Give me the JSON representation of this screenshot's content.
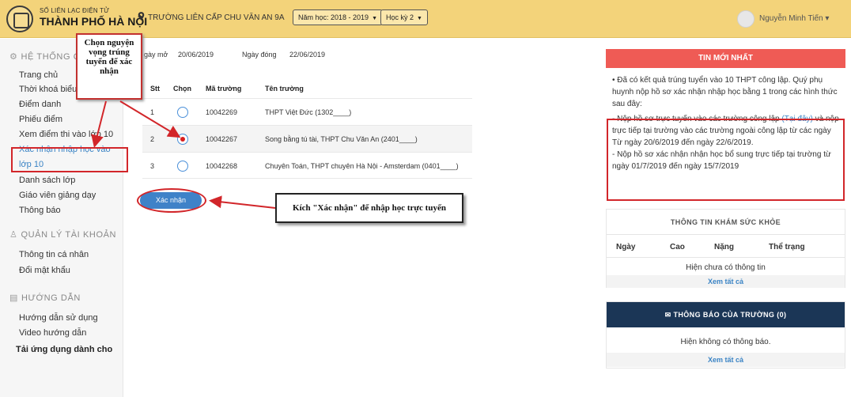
{
  "header": {
    "brand_small": "SỐ LIÊN LẠC ĐIỆN TỬ",
    "brand_big": "THÀNH PHỐ HÀ NỘI",
    "school": "TRƯỜNG LIÊN CẤP CHU VĂN AN 9A",
    "year_select": "Năm học: 2018 - 2019",
    "term_select": "Học kỳ 2",
    "user_name": "Nguyễn Minh Tiến",
    "user_caret": "▾",
    "accent": "#f3d37a"
  },
  "sidebar": {
    "section1": "HỆ THỐNG QU",
    "items1": [
      "Trang chủ",
      "Thời khoá biểu",
      "Điểm danh",
      "Phiếu điểm",
      "Xem điểm thi vào lớp 10",
      "Xác nhận nhập học vào",
      "lớp 10",
      "Danh sách lớp",
      "Giáo viên giảng dạy",
      "Thông báo"
    ],
    "section2": "QUẢN LÝ TÀI KHOẢN",
    "items2": [
      "Thông tin cá nhân",
      "Đổi mật khẩu"
    ],
    "section3": "HƯỚNG DẪN",
    "items3": [
      "Hướng dẫn sử dụng",
      "Video hướng dẫn"
    ],
    "download": "Tải ứng dụng dành cho"
  },
  "main": {
    "open_label": "gày mở",
    "open_date": "20/06/2019",
    "close_label": "Ngày đóng",
    "close_date": "22/06/2019",
    "columns": [
      "Stt",
      "Chọn",
      "Mã trường",
      "Tên trường"
    ],
    "rows": [
      {
        "stt": "1",
        "code": "10042269",
        "name": "THPT Việt Đức (1302____)",
        "selected": false
      },
      {
        "stt": "2",
        "code": "10042267",
        "name": "Song bằng tú tài, THPT Chu Văn An (2401____)",
        "selected": true
      },
      {
        "stt": "3",
        "code": "10042268",
        "name": "Chuyên Toán, THPT chuyên Hà Nội - Amsterdam (0401____)",
        "selected": false
      }
    ],
    "confirm": "Xác nhận"
  },
  "callouts": {
    "choose": [
      "Chọn nguyện",
      "vọng trúng",
      "tuyển để xác",
      "nhận"
    ],
    "confirm_hint": "Kích \"Xác nhận\" để nhập học trực tuyến"
  },
  "news": {
    "title": "TIN MỚI NHẤT",
    "intro": "• Đã có kết quả trúng tuyển vào 10 THPT công lập. Quý phụ huynh nộp hồ sơ xác nhận nhập học bằng 1 trong các hình thức sau đây:",
    "line1_a": "-     Nộp hồ sơ trực tuyến vào các trường công lập",
    "line1_link": "(Tại đây)",
    "line1_b": "và nộp trực tiếp tại trường vào các trường ngoài công lập từ các ngày Từ ngày 20/6/2019 đến ngày 22/6/2019.",
    "line2": "-     Nộp hồ sơ xác nhận nhận học bổ sung trực tiếp tại trường từ ngày 01/7/2019 đến ngày 15/7/2019"
  },
  "health": {
    "title": "THÔNG TIN KHÁM SỨC KHỎE",
    "columns": [
      "Ngày",
      "Cao",
      "Nặng",
      "Thể trạng"
    ],
    "empty": "Hiện chưa có thông tin",
    "more": "Xem tất cả"
  },
  "notice": {
    "title": "THÔNG BÁO CỦA TRƯỜNG",
    "count": "(0)",
    "empty": "Hiện không có thông báo.",
    "more": "Xem tất cả"
  }
}
